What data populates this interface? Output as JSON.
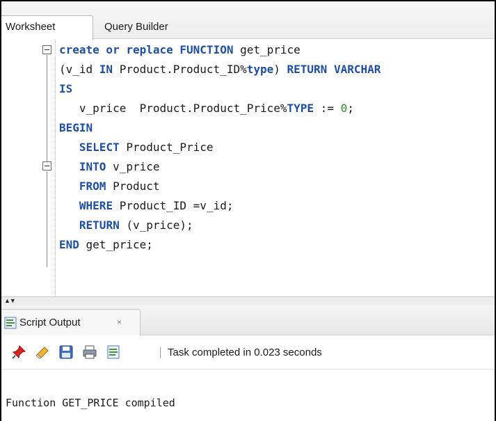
{
  "tabs": [
    {
      "label": "Worksheet"
    },
    {
      "label": "Query Builder"
    }
  ],
  "editor": {
    "lines": [
      [
        {
          "t": "create or replace FUNCTION",
          "k": "kw"
        },
        {
          "t": " get_price",
          "k": ""
        }
      ],
      [
        {
          "t": "(v_id ",
          "k": ""
        },
        {
          "t": "IN",
          "k": "kw"
        },
        {
          "t": " Product.Product_ID%",
          "k": ""
        },
        {
          "t": "type",
          "k": "kw"
        },
        {
          "t": ") ",
          "k": ""
        },
        {
          "t": "RETURN VARCHAR",
          "k": "kw"
        }
      ],
      [
        {
          "t": "IS",
          "k": "kw"
        }
      ],
      [
        {
          "t": "   v_price  Product.Product_Price%",
          "k": ""
        },
        {
          "t": "TYPE",
          "k": "kw"
        },
        {
          "t": " := ",
          "k": ""
        },
        {
          "t": "0",
          "k": "num"
        },
        {
          "t": ";",
          "k": ""
        }
      ],
      [
        {
          "t": "BEGIN",
          "k": "kw"
        }
      ],
      [
        {
          "t": "   ",
          "k": ""
        },
        {
          "t": "SELECT",
          "k": "kw"
        },
        {
          "t": " Product_Price",
          "k": ""
        }
      ],
      [
        {
          "t": "   ",
          "k": ""
        },
        {
          "t": "INTO",
          "k": "kw"
        },
        {
          "t": " v_price",
          "k": ""
        }
      ],
      [
        {
          "t": "   ",
          "k": ""
        },
        {
          "t": "FROM",
          "k": "kw"
        },
        {
          "t": " Product",
          "k": ""
        }
      ],
      [
        {
          "t": "   ",
          "k": ""
        },
        {
          "t": "WHERE",
          "k": "kw"
        },
        {
          "t": " Product_ID =v_id;",
          "k": ""
        }
      ],
      [
        {
          "t": "   ",
          "k": ""
        },
        {
          "t": "RETURN",
          "k": "kw"
        },
        {
          "t": " (v_price);",
          "k": ""
        }
      ],
      [
        {
          "t": "END",
          "k": "kw"
        },
        {
          "t": " get_price;",
          "k": ""
        }
      ]
    ]
  },
  "output_panel": {
    "tab_label": "Script Output",
    "close_glyph": "×",
    "toolbar_icons": [
      "pin-icon",
      "eraser-icon",
      "save-icon",
      "print-icon",
      "script-icon"
    ],
    "status": "Task completed in 0.023 seconds",
    "result": "Function GET_PRICE compiled"
  },
  "colors": {
    "keyword": "#1f4fa0",
    "number": "#2e8b2e"
  }
}
